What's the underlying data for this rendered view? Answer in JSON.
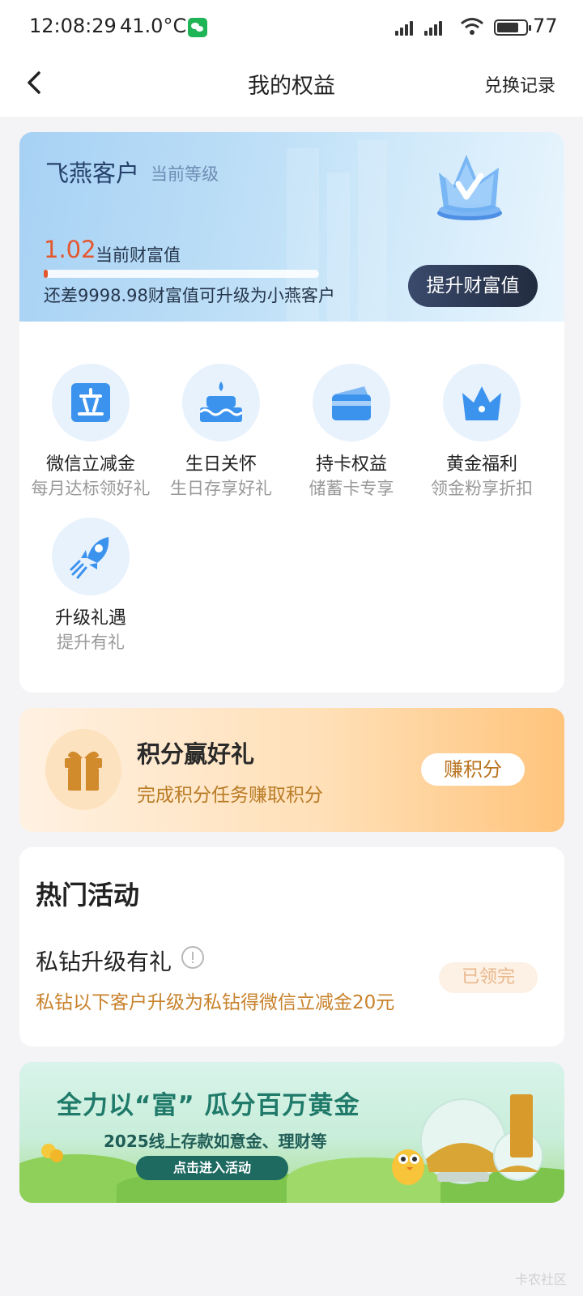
{
  "status_bar": {
    "time": "12:08:29",
    "temperature": "41.0°C",
    "battery": "77",
    "battery_level": 0.77,
    "icons": [
      "wechat-icon",
      "signal-icon",
      "signal-icon",
      "wifi-icon",
      "battery-icon"
    ]
  },
  "nav": {
    "title": "我的权益",
    "right_action": "兑换记录",
    "back_icon": "chevron-left-icon"
  },
  "level": {
    "name": "飞燕客户",
    "subtitle": "当前等级",
    "wealth_value": "1.02",
    "wealth_label": "当前财富值",
    "progress_fraction": 0.0001,
    "upgrade_tip": "还差9998.98财富值可升级为小燕客户",
    "raise_button": "提升财富值",
    "crown_icon": "crown-badge-icon",
    "accent_color": "#e4572e"
  },
  "benefits": [
    {
      "title": "微信立减金",
      "subtitle": "每月达标领好礼",
      "icon": "li-square-icon"
    },
    {
      "title": "生日关怀",
      "subtitle": "生日存享好礼",
      "icon": "cake-icon"
    },
    {
      "title": "持卡权益",
      "subtitle": "储蓄卡专享",
      "icon": "card-icon"
    },
    {
      "title": "黄金福利",
      "subtitle": "领金粉享折扣",
      "icon": "crown-icon"
    },
    {
      "title": "升级礼遇",
      "subtitle": "提升有礼",
      "icon": "rocket-icon"
    }
  ],
  "points": {
    "title": "积分赢好礼",
    "desc": "完成积分任务赚取积分",
    "button": "赚积分",
    "icon": "gift-icon"
  },
  "hot": {
    "title": "热门活动",
    "activity_name": "私钻升级有礼",
    "activity_desc": "私钻以下客户升级为私钻得微信立减金20元",
    "status_button": "已领完",
    "info_icon": "info-icon"
  },
  "banner": {
    "title": "全力以“富” 瓜分百万黄金",
    "subtitle": "2025线上存款如意金、理财等",
    "button": "点击进入活动"
  },
  "watermark": "卡农社区"
}
